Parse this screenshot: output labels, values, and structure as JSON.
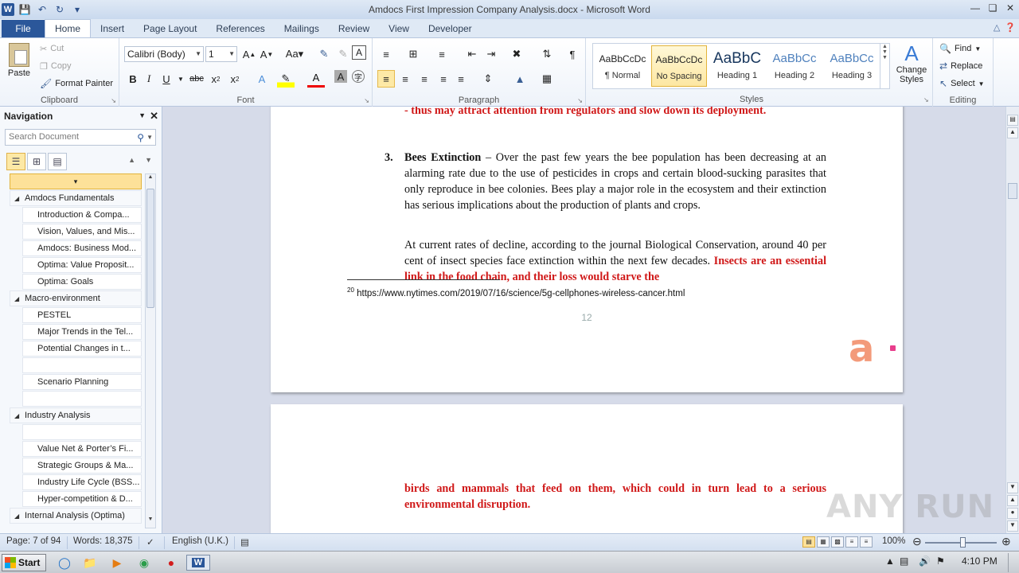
{
  "window": {
    "title": "Amdocs First Impression Company Analysis.docx  -  Microsoft Word",
    "app_letter": "W"
  },
  "tabs": [
    "File",
    "Home",
    "Insert",
    "Page Layout",
    "References",
    "Mailings",
    "Review",
    "View",
    "Developer"
  ],
  "active_tab": "Home",
  "ribbon": {
    "clipboard": {
      "paste": "Paste",
      "cut": "Cut",
      "copy": "Copy",
      "format_painter": "Format Painter",
      "label": "Clipboard"
    },
    "font": {
      "font_name": "Calibri (Body)",
      "font_size": "1",
      "label": "Font"
    },
    "paragraph": {
      "label": "Paragraph"
    },
    "styles": {
      "items": [
        {
          "sample": "AaBbCcDc",
          "name": "¶ Normal"
        },
        {
          "sample": "AaBbCcDc",
          "name": "No Spacing"
        },
        {
          "sample": "AaBbC",
          "name": "Heading 1"
        },
        {
          "sample": "AaBbCc",
          "name": "Heading 2"
        },
        {
          "sample": "AaBbCc",
          "name": "Heading 3"
        }
      ],
      "change_styles": "Change Styles",
      "label": "Styles"
    },
    "editing": {
      "find": "Find",
      "replace": "Replace",
      "select": "Select",
      "label": "Editing"
    }
  },
  "navigation": {
    "title": "Navigation",
    "search_placeholder": "Search Document",
    "items": [
      {
        "level": 1,
        "label": "Amdocs Fundamentals"
      },
      {
        "level": 2,
        "label": "Introduction & Compa..."
      },
      {
        "level": 2,
        "label": "Vision, Values, and Mis..."
      },
      {
        "level": 2,
        "label": "Amdocs: Business Mod..."
      },
      {
        "level": 2,
        "label": "Optima: Value Proposit..."
      },
      {
        "level": 2,
        "label": "Optima: Goals"
      },
      {
        "level": 1,
        "label": "Macro-environment"
      },
      {
        "level": 2,
        "label": "PESTEL"
      },
      {
        "level": 2,
        "label": "Major Trends in the Tel..."
      },
      {
        "level": 2,
        "label": "Potential Changes in t..."
      },
      {
        "level": 2,
        "label": ""
      },
      {
        "level": 2,
        "label": "Scenario Planning"
      },
      {
        "level": 2,
        "label": ""
      },
      {
        "level": 1,
        "label": "Industry Analysis"
      },
      {
        "level": 2,
        "label": ""
      },
      {
        "level": 2,
        "label": "Value Net & Porter’s Fi..."
      },
      {
        "level": 2,
        "label": "Strategic Groups & Ma..."
      },
      {
        "level": 2,
        "label": "Industry Life Cycle (BSS..."
      },
      {
        "level": 2,
        "label": "Hyper-competition & D..."
      },
      {
        "level": 1,
        "label": "Internal Analysis (Optima)"
      }
    ]
  },
  "document": {
    "top_red_line": "- thus may attract attention from regulators and slow down its deployment.",
    "item_number": "3.",
    "item_heading": "Bees Extinction",
    "item_body": " – Over the past few years the bee population has been decreasing at an alarming rate due to the use of pesticides in crops and certain blood-sucking parasites that only reproduce in bee colonies. Bees play a major role in the ecosystem and their extinction has serious implications about the production of plants and crops.",
    "para2_normal": "At current rates of decline, according to the journal Biological Conservation, around 40 per cent of insect species face extinction within the next few decades.",
    "para2_red": "Insects are an essential link in the food chain, and their loss would starve the",
    "footnote_num": "20",
    "footnote_text": "https://www.nytimes.com/2019/07/16/science/5g-cellphones-wireless-cancer.html",
    "page_number": "12",
    "page2_red": "birds and mammals that feed on them, which could in turn lead to a serious environmental disruption."
  },
  "status": {
    "page": "Page: 7 of 94",
    "words": "Words: 18,375",
    "language": "English (U.K.)",
    "zoom": "100%"
  },
  "taskbar": {
    "start": "Start",
    "clock": "4:10 PM"
  },
  "watermark": "ANY RUN"
}
